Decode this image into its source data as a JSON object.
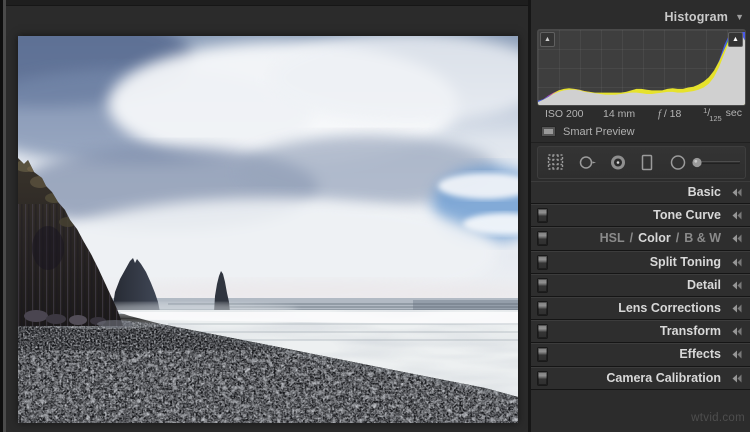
{
  "header": {
    "title": "Histogram",
    "collapse_icon": "▼"
  },
  "histogram": {
    "info": {
      "iso": "ISO 200",
      "focal_length": "14 mm",
      "aperture_prefix": "f",
      "aperture_value": " / 18",
      "shutter_numerator": "1",
      "shutter_slash": "/",
      "shutter_denominator": "125",
      "shutter_unit": " sec"
    },
    "clipping_indicator": "▲",
    "gray": [
      4,
      7,
      11,
      15,
      18,
      20,
      21,
      21,
      20,
      18,
      17,
      16,
      15,
      14,
      14,
      14,
      15,
      16,
      17,
      17,
      16,
      15,
      15,
      16,
      17,
      18,
      18,
      17,
      17,
      18,
      19,
      21,
      24,
      29,
      38,
      52,
      70,
      88,
      98,
      100,
      88
    ],
    "yellow": [
      0,
      0,
      0,
      1,
      2,
      2,
      2,
      1,
      1,
      1,
      1,
      1,
      2,
      3,
      3,
      3,
      2,
      2,
      3,
      5,
      6,
      6,
      5,
      4,
      3,
      4,
      5,
      5,
      5,
      6,
      6,
      7,
      8,
      9,
      9,
      8,
      6,
      3,
      0,
      0,
      0
    ],
    "blue": [
      2,
      1,
      1,
      0,
      0,
      0,
      0,
      0,
      0,
      0,
      0,
      0,
      0,
      0,
      0,
      0,
      0,
      0,
      0,
      0,
      0,
      0,
      0,
      1,
      1,
      1,
      1,
      1,
      2,
      2,
      3,
      3,
      4,
      5,
      7,
      9,
      12,
      9,
      4,
      0,
      12
    ],
    "green": [
      0,
      0,
      0,
      0,
      0,
      0,
      0,
      0,
      0,
      0,
      0,
      0,
      0,
      0,
      0,
      0,
      0,
      0,
      0,
      0,
      0,
      0,
      0,
      0,
      0,
      0,
      0,
      0,
      0,
      1,
      1,
      2,
      2,
      3,
      4,
      5,
      6,
      7,
      3,
      0,
      0
    ],
    "magenta": [
      1,
      1,
      2,
      2,
      2,
      1,
      1,
      1,
      1,
      1,
      1,
      0,
      0,
      0,
      0,
      0,
      0,
      0,
      0,
      0,
      0,
      0,
      0,
      0,
      0,
      0,
      0,
      0,
      1,
      1,
      1,
      2,
      2,
      3,
      4,
      5,
      6,
      4,
      2,
      0,
      6
    ],
    "colors": {
      "gray": "#d0d0d0",
      "yellow": "#e6e22c",
      "blue": "#4a5ae8",
      "green": "#43a94c",
      "magenta": "#b93ec0"
    }
  },
  "smart_preview": {
    "label": "Smart Preview"
  },
  "tools": [
    "crop",
    "spot-removal",
    "red-eye",
    "graduated-filter",
    "radial-filter",
    "adjustment-brush"
  ],
  "panels": [
    {
      "label": "Basic",
      "toggle": false
    },
    {
      "label": "Tone Curve",
      "toggle": true
    },
    {
      "segments": [
        {
          "text": "HSL",
          "dim": true
        },
        {
          "text": "/",
          "dim": true
        },
        {
          "text": "Color",
          "dim": false
        },
        {
          "text": "/",
          "dim": true
        },
        {
          "text": "B & W",
          "dim": true
        }
      ],
      "toggle": true,
      "slug": "hsl-color-bw"
    },
    {
      "label": "Split Toning",
      "toggle": true
    },
    {
      "label": "Detail",
      "toggle": true
    },
    {
      "label": "Lens Corrections",
      "toggle": true
    },
    {
      "label": "Transform",
      "toggle": true
    },
    {
      "label": "Effects",
      "toggle": true
    },
    {
      "label": "Camera Calibration",
      "toggle": true
    }
  ],
  "watermark": "wtvid.com",
  "photo": {
    "description": "Black sand beach with basalt cliff and two sea stacks under dramatic clouds"
  }
}
